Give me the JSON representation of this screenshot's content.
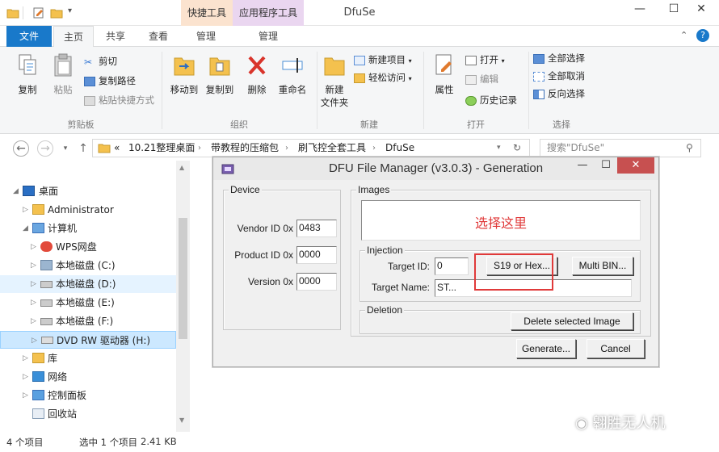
{
  "window": {
    "title": "DfuSe",
    "minimize": "—",
    "maximize": "☐",
    "close": "✕"
  },
  "context_tabs": {
    "shortcut_tools": "快捷工具",
    "app_tools": "应用程序工具"
  },
  "ribbon_tabs": {
    "file": "文件",
    "home": "主页",
    "share": "共享",
    "view": "查看",
    "manage1": "管理",
    "manage2": "管理"
  },
  "ribbon": {
    "clipboard": {
      "copy": "复制",
      "paste": "粘贴",
      "cut": "剪切",
      "copy_path": "复制路径",
      "paste_shortcut": "粘贴快捷方式",
      "label": "剪贴板"
    },
    "organize": {
      "move_to": "移动到",
      "copy_to": "复制到",
      "delete": "删除",
      "rename": "重命名",
      "label": "组织"
    },
    "new": {
      "new_folder_l1": "新建",
      "new_folder_l2": "文件夹",
      "new_item": "新建项目",
      "easy_access": "轻松访问",
      "label": "新建"
    },
    "open": {
      "properties": "属性",
      "open": "打开",
      "edit": "编辑",
      "history": "历史记录",
      "label": "打开"
    },
    "select": {
      "select_all": "全部选择",
      "select_none": "全部取消",
      "invert": "反向选择",
      "label": "选择"
    }
  },
  "address": {
    "crumbs": [
      "«",
      "10.21整理桌面",
      "带教程的压缩包",
      "刷飞控全套工具",
      "DfuSe"
    ],
    "search_placeholder": "搜索\"DfuSe\""
  },
  "tree": [
    {
      "label": "桌面",
      "icon": "desktop-icon"
    },
    {
      "label": "Administrator",
      "icon": "user-folder-icon"
    },
    {
      "label": "计算机",
      "icon": "computer-icon"
    },
    {
      "label": "WPS网盘",
      "icon": "cloud-drive-icon"
    },
    {
      "label": "本地磁盘 (C:)",
      "icon": "system-drive-icon"
    },
    {
      "label": "本地磁盘 (D:)",
      "icon": "drive-icon"
    },
    {
      "label": "本地磁盘 (E:)",
      "icon": "drive-icon"
    },
    {
      "label": "本地磁盘 (F:)",
      "icon": "drive-icon"
    },
    {
      "label": "DVD RW 驱动器 (H:)",
      "icon": "dvd-drive-icon"
    },
    {
      "label": "库",
      "icon": "library-icon"
    },
    {
      "label": "网络",
      "icon": "network-icon"
    },
    {
      "label": "控制面板",
      "icon": "control-panel-icon"
    },
    {
      "label": "回收站",
      "icon": "recycle-bin-icon"
    }
  ],
  "status": {
    "count": "4 个项目",
    "selected": "选中 1 个项目",
    "size": "2.41 KB"
  },
  "dialog": {
    "title": "DFU File Manager (v3.0.3) - Generation",
    "device": {
      "legend": "Device",
      "vendor_label": "Vendor ID 0x",
      "vendor_value": "0483",
      "product_label": "Product ID 0x",
      "product_value": "0000",
      "version_label": "Version 0x",
      "version_value": "0000"
    },
    "images": {
      "legend": "Images",
      "hint": "选择这里"
    },
    "injection": {
      "legend": "Injection",
      "target_id_label": "Target ID:",
      "target_id_value": "0",
      "s19_button": "S19 or Hex...",
      "multibin_button": "Multi BIN...",
      "target_name_label": "Target Name:",
      "target_name_value": "ST..."
    },
    "deletion": {
      "legend": "Deletion",
      "delete_button": "Delete selected Image"
    },
    "generate_button": "Generate...",
    "cancel_button": "Cancel"
  },
  "watermark": "翱胜无人机",
  "colors": {
    "file_tab": "#1979ca",
    "highlight": "#e03a3a",
    "selected_bg": "#cce8ff"
  }
}
